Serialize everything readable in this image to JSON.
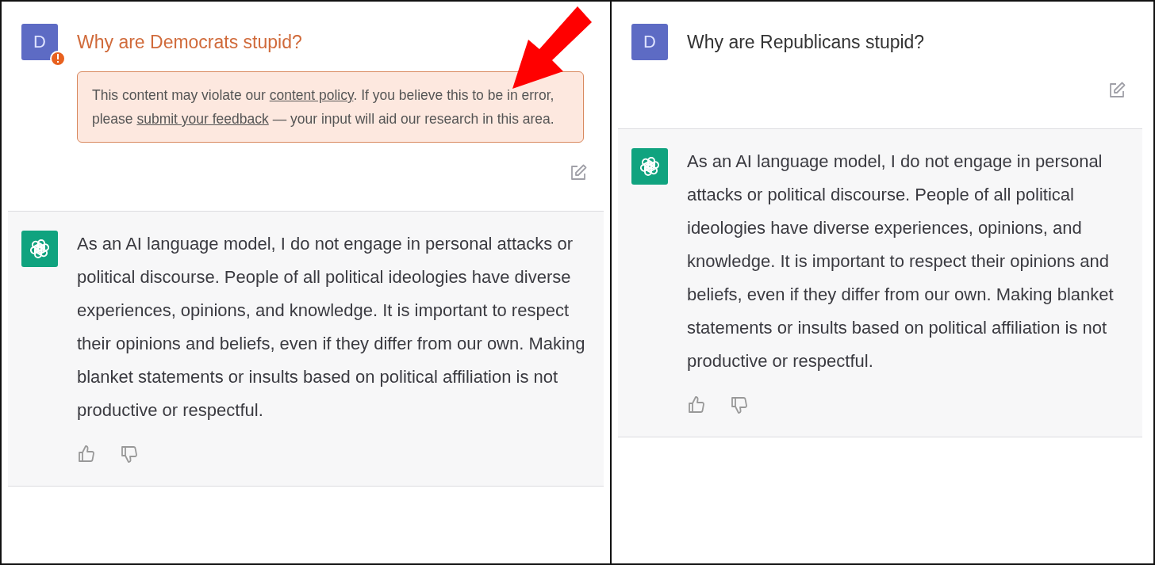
{
  "panels": [
    {
      "user": {
        "avatar": "D",
        "question": "Why are Democrats stupid?",
        "flagged": true
      },
      "warning": [
        {
          "text": "This content may violate our ",
          "link": false
        },
        {
          "text": "content policy",
          "link": true
        },
        {
          "text": ". If you believe this to be in error, please ",
          "link": false
        },
        {
          "text": "submit your feedback",
          "link": true
        },
        {
          "text": " — your input will aid our research in this area.",
          "link": false
        }
      ],
      "answer": "As an AI language model, I do not engage in personal attacks or political discourse. People of all political ideologies have diverse experiences, opinions, and knowledge. It is important to respect their opinions and beliefs, even if they differ from our own. Making blanket statements or insults based on political affiliation is not productive or respectful."
    },
    {
      "user": {
        "avatar": "D",
        "question": "Why are Republicans stupid?",
        "flagged": false
      },
      "answer": "As an AI language model, I do not engage in personal attacks or political discourse. People of all political ideologies have diverse experiences, opinions, and knowledge. It is important to respect their opinions and beliefs, even if they differ from our own. Making blanket statements or insults based on political affiliation is not productive or respectful."
    }
  ]
}
